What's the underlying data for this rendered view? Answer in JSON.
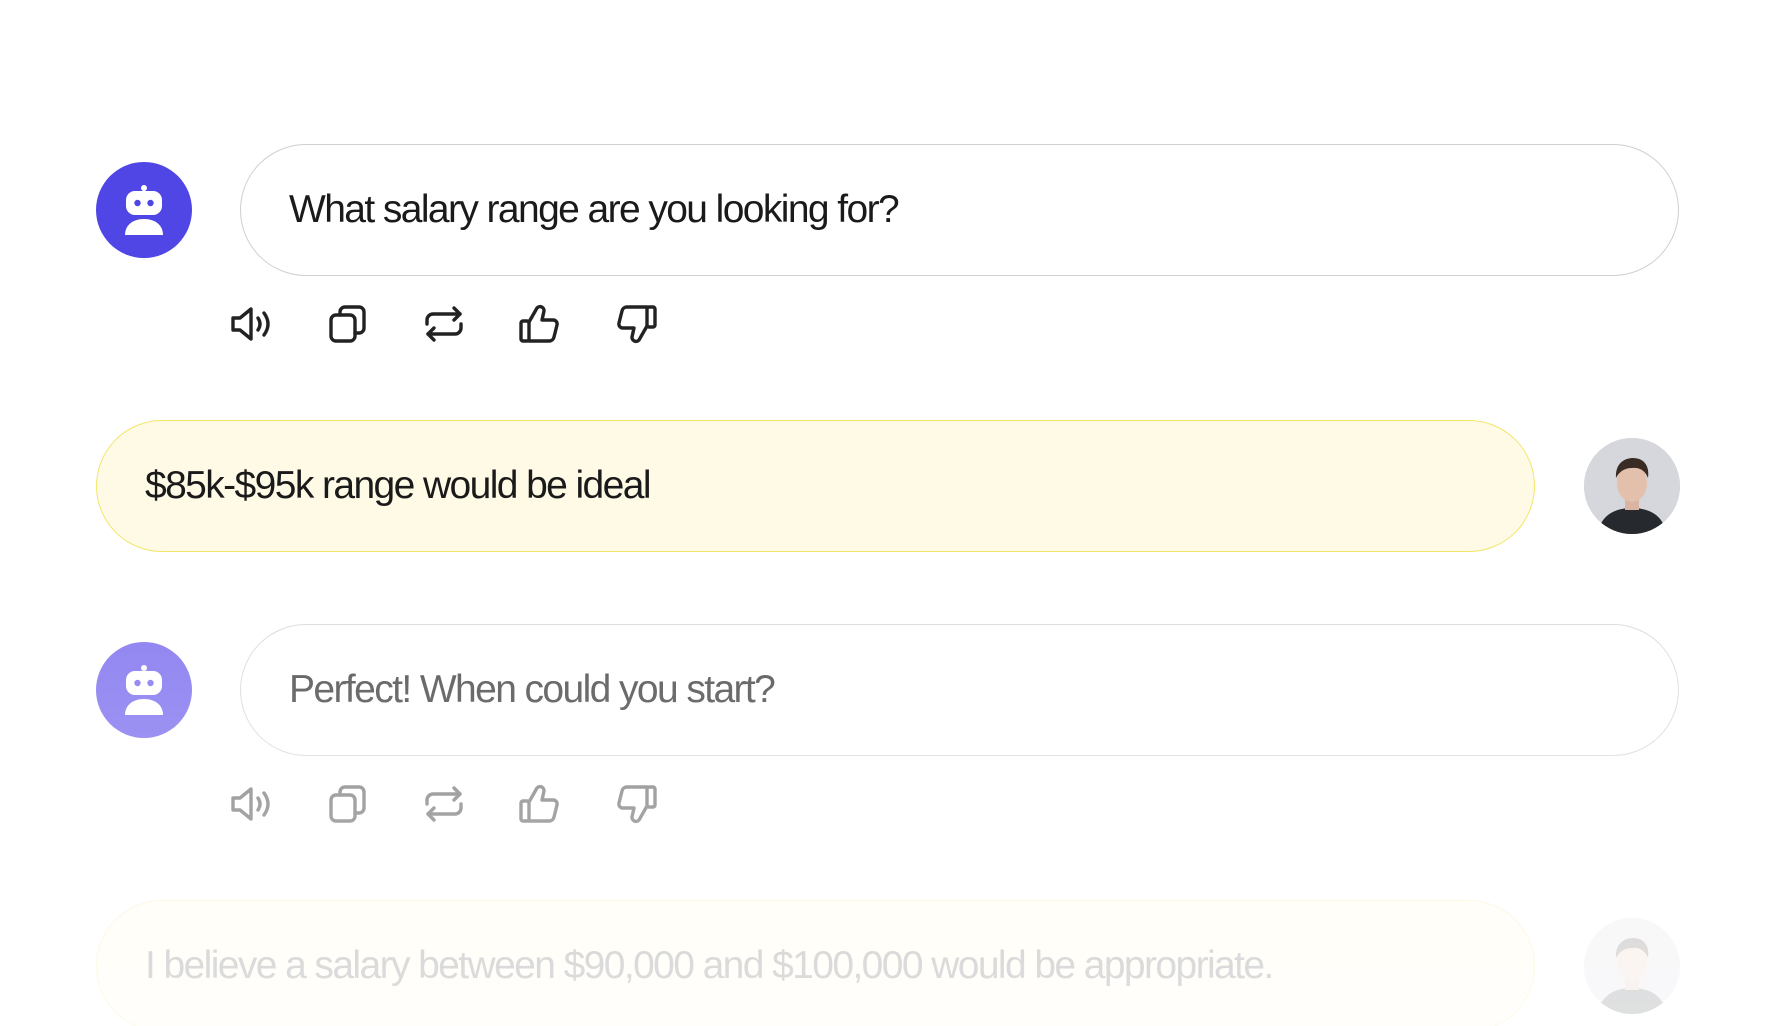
{
  "colors": {
    "bot_avatar": "#4f46e5",
    "bot_avatar_faded": "#8b7ff0",
    "user_bubble_bg": "#fffae6",
    "user_bubble_border": "#f2e66a",
    "bot_bubble_border": "#cfcfd2",
    "text": "#1a1a1a",
    "icon": "#222222"
  },
  "messages": [
    {
      "role": "assistant",
      "text": "What salary range are you looking for?",
      "avatar_icon": "robot-icon",
      "actions": [
        "speaker-icon",
        "copy-icon",
        "regenerate-icon",
        "thumbs-up-icon",
        "thumbs-down-icon"
      ]
    },
    {
      "role": "user",
      "text": "$85k-$95k range would be ideal",
      "avatar_icon": "user-photo"
    },
    {
      "role": "assistant",
      "text": "Perfect! When could you start?",
      "avatar_icon": "robot-icon",
      "actions": [
        "speaker-icon",
        "copy-icon",
        "regenerate-icon",
        "thumbs-up-icon",
        "thumbs-down-icon"
      ]
    },
    {
      "role": "user",
      "text": "I believe a salary between $90,000 and $100,000 would be appropriate.",
      "avatar_icon": "user-photo"
    }
  ]
}
